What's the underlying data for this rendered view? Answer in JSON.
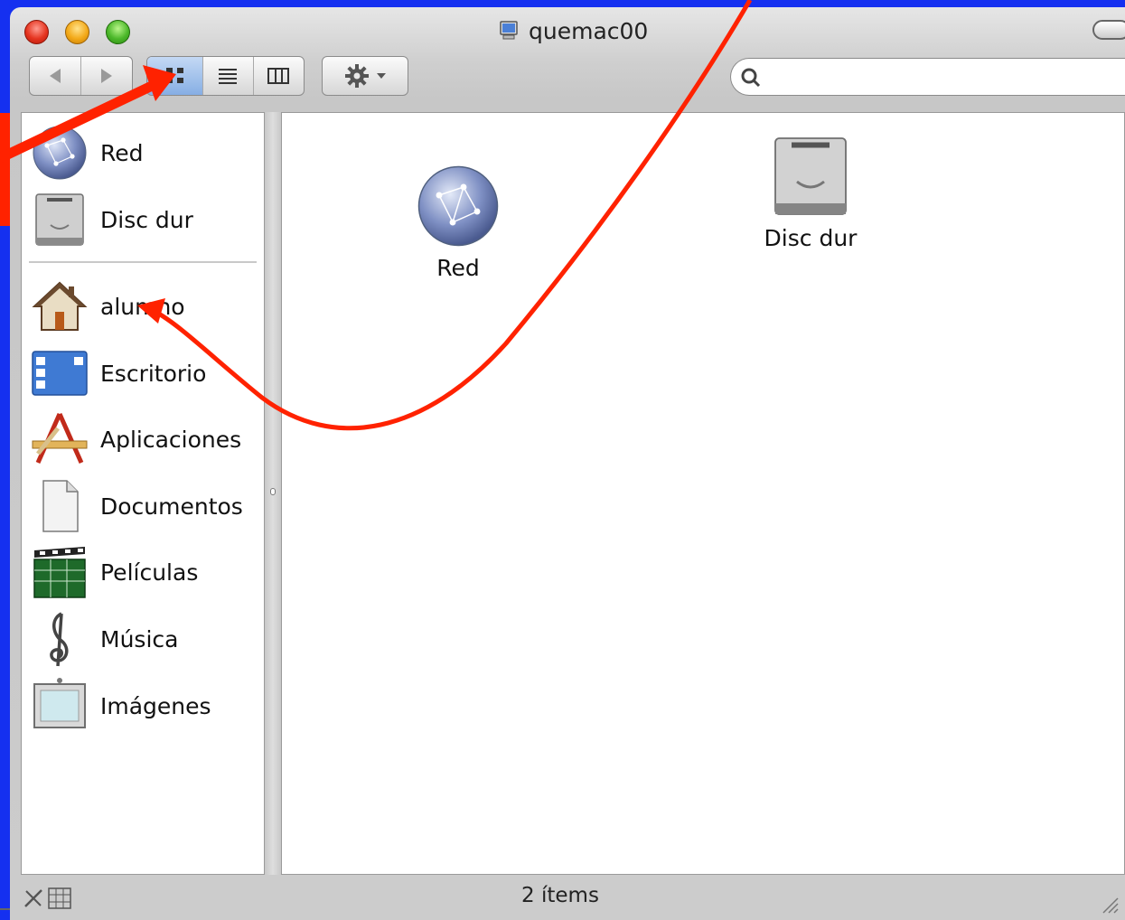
{
  "window": {
    "title": "quemac00",
    "status": "2 ítems"
  },
  "toolbar": {
    "nav": [
      "back-arrow-icon",
      "forward-arrow-icon"
    ],
    "view_modes": [
      "icon-view-icon",
      "list-view-icon",
      "column-view-icon"
    ],
    "selected_view": "icon-view",
    "action": "gear-icon",
    "search_placeholder": ""
  },
  "sidebar": {
    "devices": [
      {
        "label": "Red",
        "icon": "network-globe-icon"
      },
      {
        "label": "Disc dur",
        "icon": "hard-disk-icon"
      }
    ],
    "places": [
      {
        "label": "alumno",
        "icon": "home-icon"
      },
      {
        "label": "Escritorio",
        "icon": "desktop-icon"
      },
      {
        "label": "Aplicaciones",
        "icon": "applications-icon"
      },
      {
        "label": "Documentos",
        "icon": "documents-icon"
      },
      {
        "label": "Películas",
        "icon": "movies-clapboard-icon"
      },
      {
        "label": "Música",
        "icon": "music-clef-icon"
      },
      {
        "label": "Imágenes",
        "icon": "pictures-frame-icon"
      }
    ]
  },
  "main": {
    "items": [
      {
        "label": "Red",
        "icon": "network-globe-icon"
      },
      {
        "label": "Disc dur",
        "icon": "hard-disk-icon"
      }
    ]
  },
  "colors": {
    "slide_background": "#1530f0",
    "annotation_arrow": "#ff2200",
    "selected_segment": "#86aee4"
  }
}
